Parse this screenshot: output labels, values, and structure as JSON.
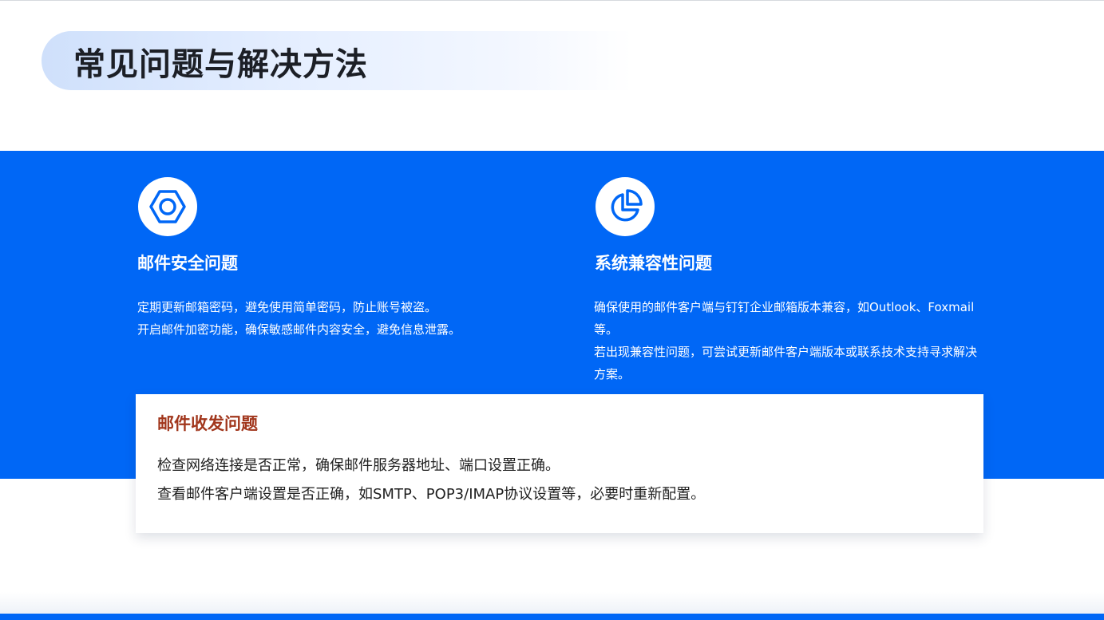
{
  "header": {
    "title": "常见问题与解决方法"
  },
  "cards": [
    {
      "icon": "hexagon-nut-icon",
      "title": "邮件安全问题",
      "lines": [
        "定期更新邮箱密码，避免使用简单密码，防止账号被盗。",
        "开启邮件加密功能，确保敏感邮件内容安全，避免信息泄露。"
      ]
    },
    {
      "icon": "pie-chart-icon",
      "title": "系统兼容性问题",
      "lines": [
        "确保使用的邮件客户端与钉钉企业邮箱版本兼容，如Outlook、Foxmail等。",
        "若出现兼容性问题，可尝试更新邮件客户端版本或联系技术支持寻求解决方案。"
      ]
    }
  ],
  "panel": {
    "title": "邮件收发问题",
    "lines": [
      "检查网络连接是否正常，确保邮件服务器地址、端口设置正确。",
      "查看邮件客户端设置是否正确，如SMTP、POP3/IMAP协议设置等，必要时重新配置。"
    ]
  },
  "colors": {
    "accent_blue": "#0067f6",
    "panel_title": "#a1361c",
    "title_text": "#1c1f26"
  }
}
